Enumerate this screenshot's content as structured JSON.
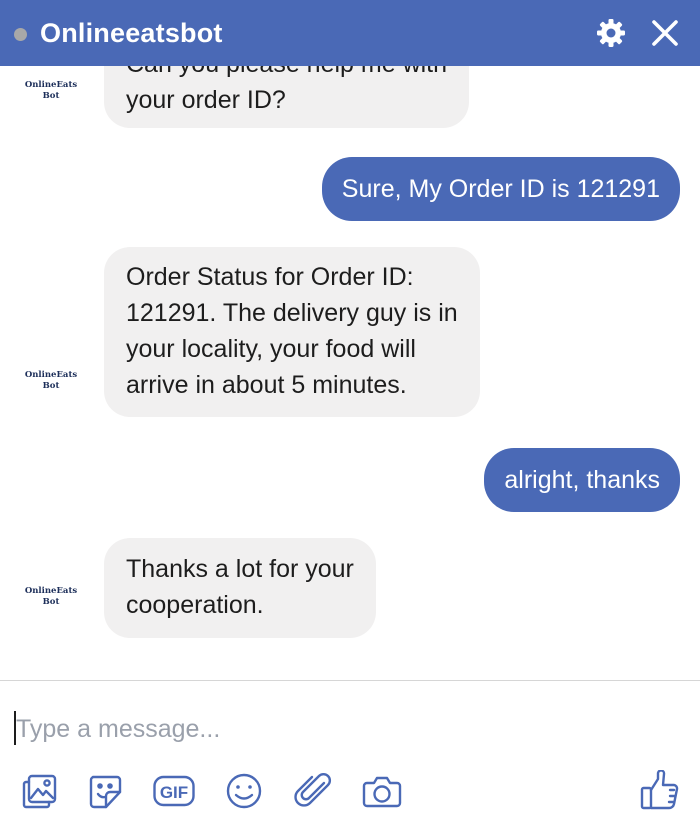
{
  "header": {
    "title": "Onlineeatsbot",
    "status_color": "#a8a8a8",
    "icons": [
      "gear-icon",
      "close-icon"
    ]
  },
  "bot": {
    "avatar_line1": "OnlineEats",
    "avatar_line2": "Bot"
  },
  "messages": [
    {
      "from": "bot",
      "text": "Can you please help me with\nyour order ID?"
    },
    {
      "from": "user",
      "text": "Sure, My Order ID is 121291"
    },
    {
      "from": "bot",
      "text": "Order Status for Order ID:\n121291. The delivery guy is in\nyour locality, your food will\narrive in about 5 minutes."
    },
    {
      "from": "user",
      "text": "alright, thanks"
    },
    {
      "from": "bot",
      "text": "Thanks a lot for your\ncooperation."
    }
  ],
  "composer": {
    "placeholder": "Type a message...",
    "value": "",
    "tools": [
      "photo-icon",
      "sticker-icon",
      "gif-icon",
      "emoji-icon",
      "paperclip-icon",
      "camera-icon",
      "thumbs-up-icon"
    ],
    "gif_label": "GIF"
  },
  "colors": {
    "accent": "#4a69b6",
    "incoming_bubble": "#f1f0f0",
    "icon": "#4a69b6"
  }
}
